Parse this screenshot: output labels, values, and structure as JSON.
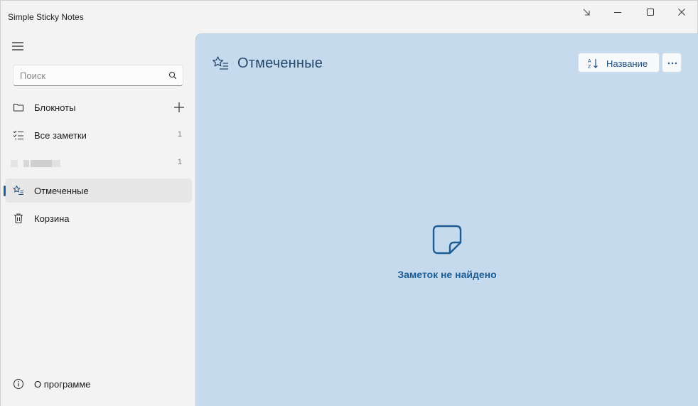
{
  "window": {
    "title": "Simple Sticky Notes"
  },
  "sidebar": {
    "search_placeholder": "Поиск",
    "items": [
      {
        "label": "Блокноты",
        "icon": "folder-icon",
        "count": ""
      },
      {
        "label": "Все заметки",
        "icon": "checklist-icon",
        "count": "1"
      },
      {
        "label": "",
        "icon": "",
        "count": "1"
      },
      {
        "label": "Отмеченные",
        "icon": "starred-list-icon",
        "count": "",
        "active": true
      },
      {
        "label": "Корзина",
        "icon": "trash-icon",
        "count": ""
      }
    ],
    "about_label": "О программе"
  },
  "main": {
    "title": "Отмеченные",
    "sort_label": "Название",
    "empty_message": "Заметок не найдено"
  },
  "colors": {
    "main_background": "#c5daec",
    "accent": "#1c5d96",
    "sidebar_background": "#f3f3f3"
  }
}
